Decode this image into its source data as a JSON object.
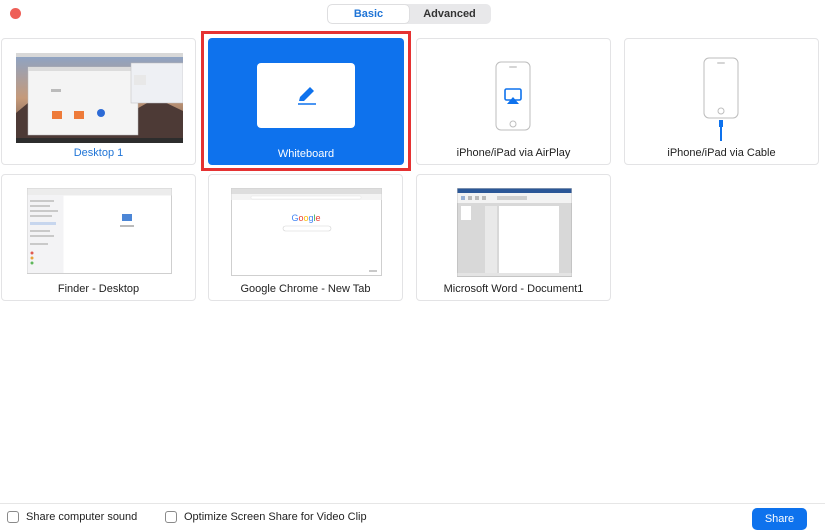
{
  "tabs": [
    {
      "label": "Basic"
    },
    {
      "label": "Advanced"
    }
  ],
  "active_tab": "Basic",
  "tiles": [
    {
      "label": "Desktop 1",
      "selected_style": "blue-label"
    },
    {
      "label": "Whiteboard"
    },
    {
      "label": "iPhone/iPad via AirPlay"
    },
    {
      "label": "iPhone/iPad via Cable"
    },
    {
      "label": "Finder - Desktop"
    },
    {
      "label": "Google Chrome - New Tab"
    },
    {
      "label": "Microsoft Word - Document1"
    }
  ],
  "chrome_thumb_logo": "Google",
  "footer": {
    "share_sound_label": "Share computer sound",
    "optimize_label": "Optimize Screen Share for Video Clip",
    "share_button_label": "Share"
  },
  "colors": {
    "accent": "#0e72ed",
    "highlight_border": "#e53232",
    "close_button": "#ee5f57"
  }
}
